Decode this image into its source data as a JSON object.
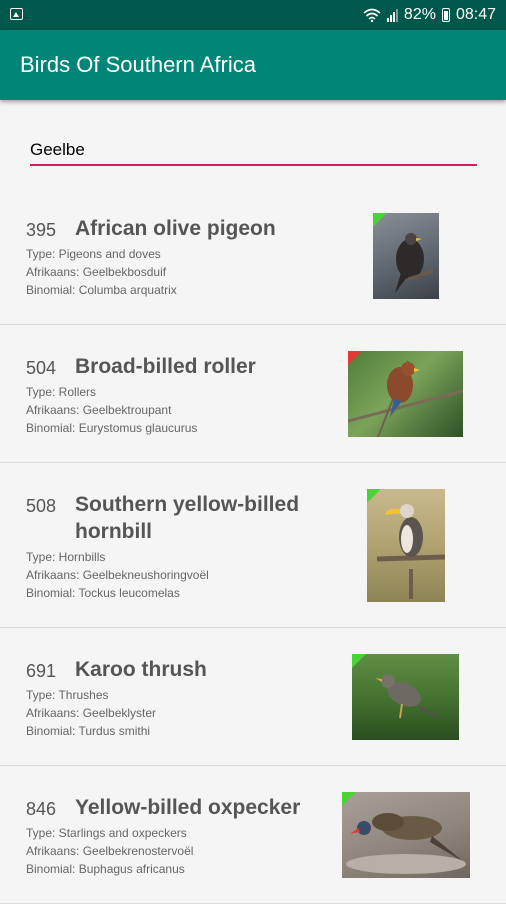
{
  "status": {
    "battery": "82%",
    "time": "08:47"
  },
  "app": {
    "title": "Birds Of Southern Africa"
  },
  "search": {
    "value": "Geelbe"
  },
  "birds": [
    {
      "number": "395",
      "name": "African olive pigeon",
      "type": "Type: Pigeons and doves",
      "afrikaans": "Afrikaans: Geelbekbosduif",
      "binomial": "Binomial: Columba arquatrix",
      "badge_color": "#4cd137"
    },
    {
      "number": "504",
      "name": "Broad-billed roller",
      "type": "Type: Rollers",
      "afrikaans": "Afrikaans: Geelbektroupant",
      "binomial": "Binomial: Eurystomus glaucurus",
      "badge_color": "#e53935"
    },
    {
      "number": "508",
      "name": "Southern yellow-billed hornbill",
      "type": "Type: Hornbills",
      "afrikaans": "Afrikaans: Geelbekneushoringvoël",
      "binomial": "Binomial: Tockus leucomelas",
      "badge_color": "#4cd137"
    },
    {
      "number": "691",
      "name": "Karoo thrush",
      "type": "Type: Thrushes",
      "afrikaans": "Afrikaans: Geelbeklyster",
      "binomial": "Binomial: Turdus smithi",
      "badge_color": "#4cd137"
    },
    {
      "number": "846",
      "name": "Yellow-billed oxpecker",
      "type": "Type: Starlings and oxpeckers",
      "afrikaans": "Afrikaans: Geelbekrenostervoël",
      "binomial": "Binomial: Buphagus africanus",
      "badge_color": "#4cd137"
    }
  ]
}
